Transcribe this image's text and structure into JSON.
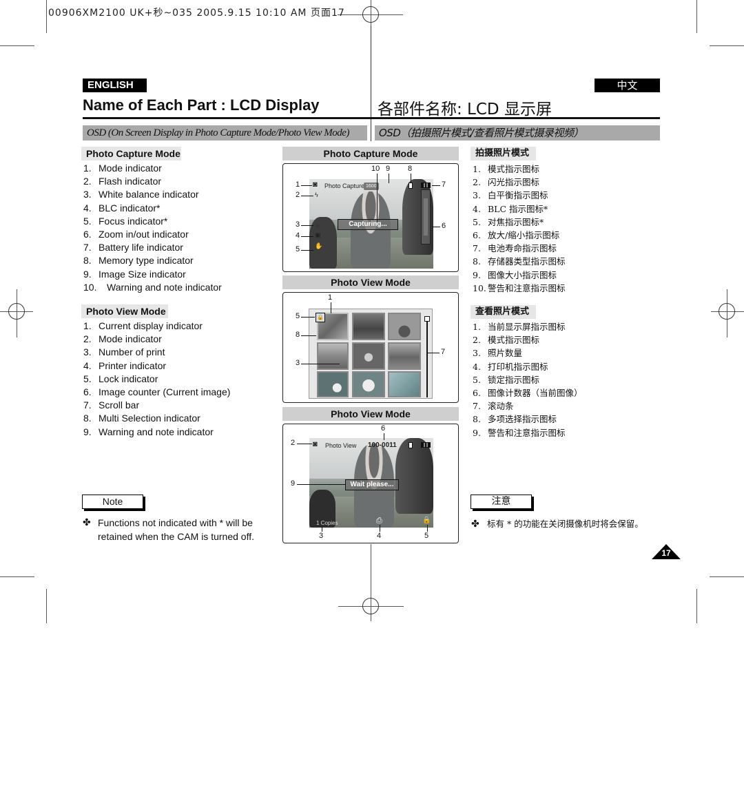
{
  "print_header": "00906XM2100 UK+秒~035  2005.9.15 10:10 AM  页面17",
  "english": {
    "lang_badge": "ENGLISH",
    "title": "Name of Each Part : LCD Display",
    "osd_bar": "OSD (On Screen Display in Photo Capture Mode/Photo View Mode)",
    "capture_section": {
      "heading": "Photo Capture Mode",
      "items": [
        {
          "num": "1.",
          "label": "Mode indicator"
        },
        {
          "num": "2.",
          "label": "Flash indicator"
        },
        {
          "num": "3.",
          "label": "White balance indicator"
        },
        {
          "num": "4.",
          "label": "BLC indicator*"
        },
        {
          "num": "5.",
          "label": "Focus indicator*"
        },
        {
          "num": "6.",
          "label": "Zoom in/out indicator"
        },
        {
          "num": "7.",
          "label": "Battery life indicator"
        },
        {
          "num": "8.",
          "label": "Memory type indicator"
        },
        {
          "num": "9.",
          "label": "Image Size indicator"
        },
        {
          "num": "10.",
          "label": "Warning and note indicator"
        }
      ]
    },
    "view_section": {
      "heading": "Photo View Mode",
      "items": [
        {
          "num": "1.",
          "label": "Current display indicator"
        },
        {
          "num": "2.",
          "label": "Mode indicator"
        },
        {
          "num": "3.",
          "label": "Number of print"
        },
        {
          "num": "4.",
          "label": "Printer indicator"
        },
        {
          "num": "5.",
          "label": "Lock indicator"
        },
        {
          "num": "6.",
          "label": "Image counter (Current image)"
        },
        {
          "num": "7.",
          "label": "Scroll bar"
        },
        {
          "num": "8.",
          "label": "Multi Selection indicator"
        },
        {
          "num": "9.",
          "label": "Warning and note indicator"
        }
      ]
    },
    "note": {
      "label": "Note",
      "bullet": "✤",
      "text_line1": "Functions not indicated with * will be",
      "text_line2": "retained when the CAM is turned off."
    }
  },
  "chinese": {
    "lang_badge": "中文",
    "title": "各部件名称:  LCD 显示屏",
    "osd_bar": "OSD（拍摄照片模式/查看照片模式摄录视频）",
    "capture_section": {
      "heading": "拍摄照片模式",
      "items": [
        {
          "num": "1.",
          "label": "模式指示图标"
        },
        {
          "num": "2.",
          "label": "闪光指示图标"
        },
        {
          "num": "3.",
          "label": "白平衡指示图标"
        },
        {
          "num": "4.",
          "label": "BLC 指示图标*"
        },
        {
          "num": "5.",
          "label": "对焦指示图标*"
        },
        {
          "num": "6.",
          "label": "放大/缩小指示图标"
        },
        {
          "num": "7.",
          "label": "电池寿命指示图标"
        },
        {
          "num": "8.",
          "label": "存储器类型指示图标"
        },
        {
          "num": "9.",
          "label": "图像大小指示图标"
        },
        {
          "num": "10.",
          "label": "警告和注意指示图标"
        }
      ]
    },
    "view_section": {
      "heading": "查看照片模式",
      "items": [
        {
          "num": "1.",
          "label": "当前显示屏指示图标"
        },
        {
          "num": "2.",
          "label": "模式指示图标"
        },
        {
          "num": "3.",
          "label": "照片数量"
        },
        {
          "num": "4.",
          "label": "打印机指示图标"
        },
        {
          "num": "5.",
          "label": "锁定指示图标"
        },
        {
          "num": "6.",
          "label": "图像计数器（当前图像）"
        },
        {
          "num": "7.",
          "label": "滚动条"
        },
        {
          "num": "8.",
          "label": "多项选择指示图标"
        },
        {
          "num": "9.",
          "label": "警告和注意指示图标"
        }
      ]
    },
    "note": {
      "label": "注意",
      "bullet": "✤",
      "text": "标有 * 的功能在关闭摄像机时将会保留。"
    }
  },
  "lcd_panels": {
    "capture": {
      "heading": "Photo Capture Mode",
      "mode_text": "Photo Capture",
      "image_size": "1600",
      "message": "Capturing...",
      "callouts": [
        "1",
        "2",
        "3",
        "4",
        "5",
        "6",
        "7",
        "8",
        "9",
        "10"
      ]
    },
    "view_grid": {
      "heading": "Photo View Mode",
      "lock_glyph": "🔒",
      "callouts": [
        "1",
        "3",
        "5",
        "7",
        "8"
      ]
    },
    "view_single": {
      "heading": "Photo View Mode",
      "mode_text": "Photo View",
      "image_counter": "100-0011",
      "message": "Wait please...",
      "copies": "1 Copies",
      "callouts": [
        "2",
        "3",
        "4",
        "5",
        "6",
        "9"
      ]
    }
  },
  "page_number": "17"
}
